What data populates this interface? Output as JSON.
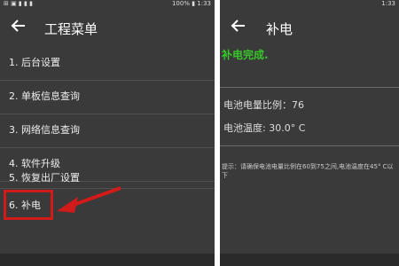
{
  "left_panel": {
    "statusbar": {
      "left": "⊞ ▣ ▮ ▮ ▮",
      "right": "100% ▮ 1:33"
    },
    "title": "工程菜单",
    "menu": [
      {
        "label": "1. 后台设置"
      },
      {
        "label": "2. 单板信息查询"
      },
      {
        "label": "3. 网络信息查询"
      },
      {
        "label": "4. 软件升级"
      },
      {
        "label": "5. 恢复出厂设置"
      },
      {
        "label": "6. 补电"
      }
    ]
  },
  "right_panel": {
    "statusbar": {
      "right": "1:33"
    },
    "title": "补电",
    "status": "补电完成.",
    "battery_ratio": "电池电量比例：76",
    "battery_temp": "电池温度: 30.0° C",
    "hint": "提示：请确保电池电量比例在60到75之间,电池温度在45° C以下"
  },
  "colors": {
    "highlight": "#d11a1a",
    "success": "#38c52a",
    "bg": "#3a3a3a"
  }
}
